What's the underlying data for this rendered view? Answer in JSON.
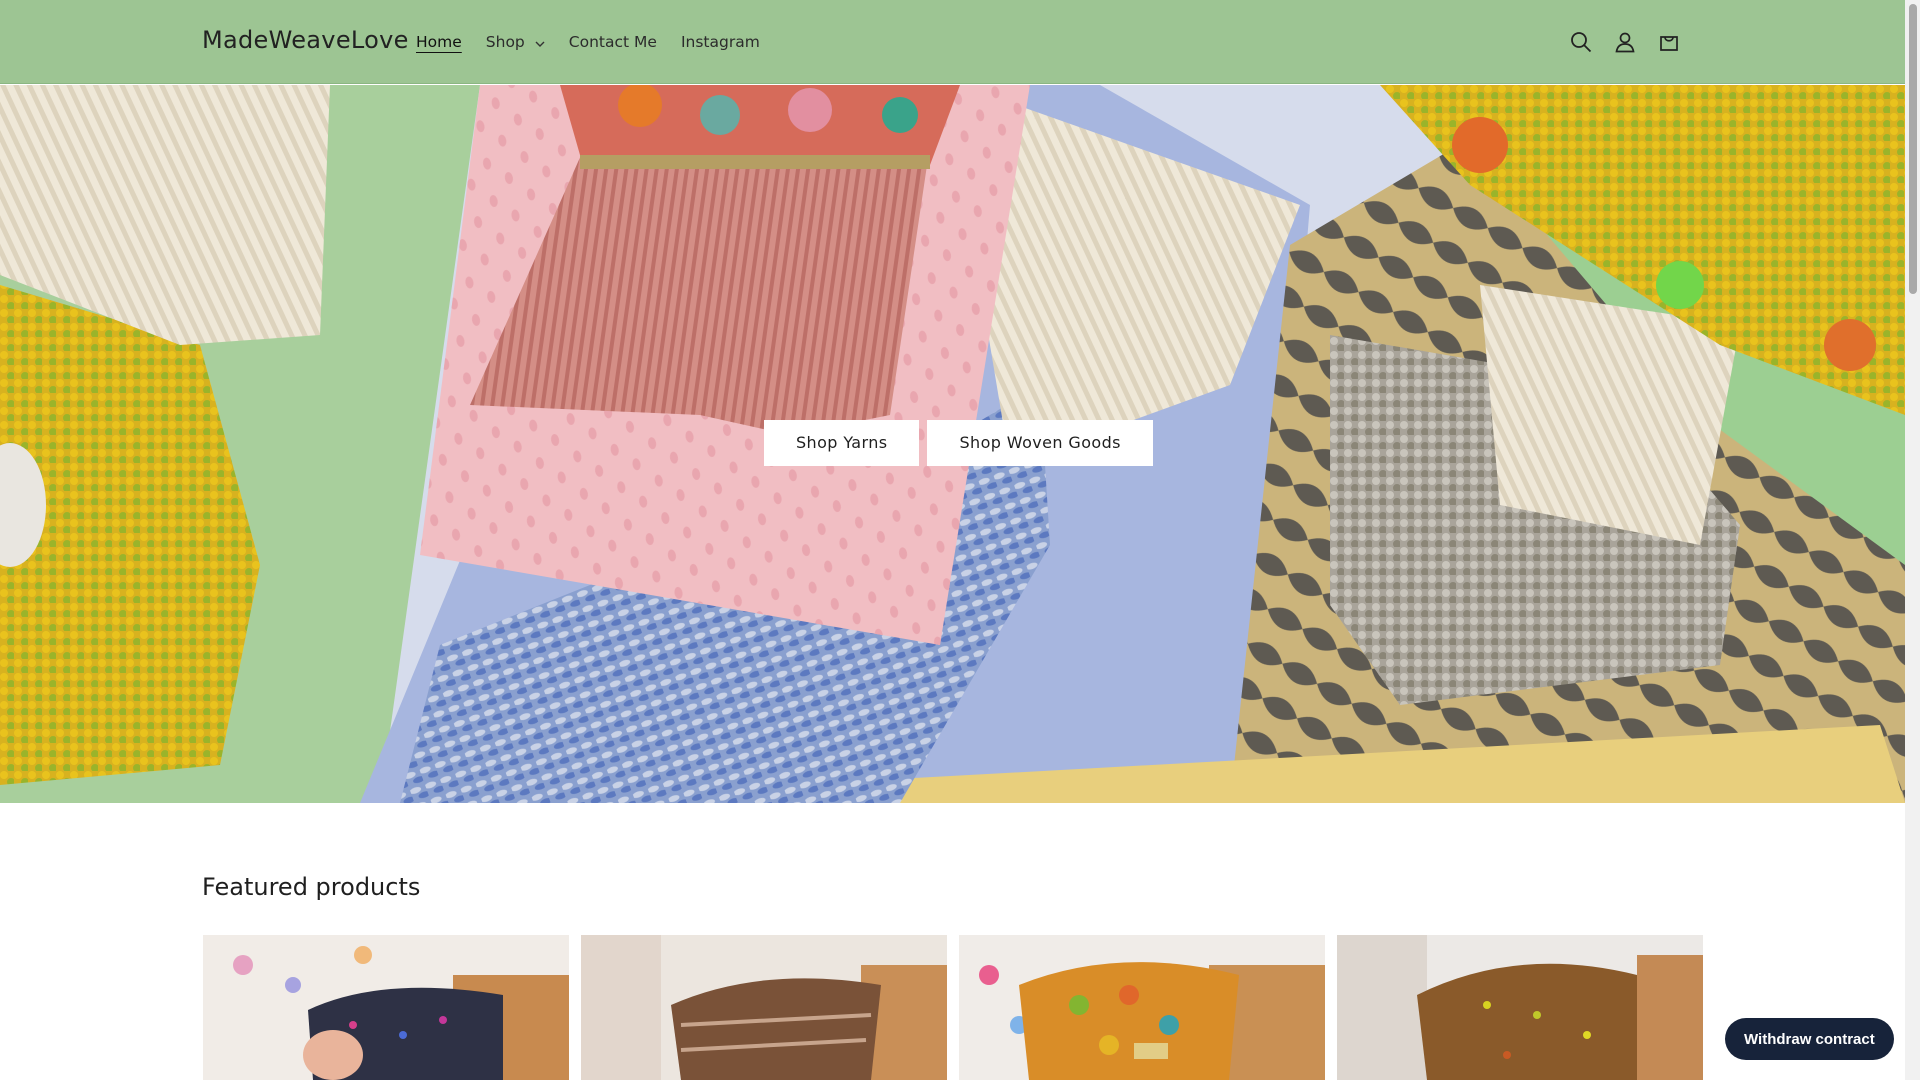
{
  "header": {
    "logo": "MadeWeaveLove",
    "nav": [
      {
        "label": "Home",
        "active": true
      },
      {
        "label": "Shop",
        "has_dropdown": true
      },
      {
        "label": "Contact Me"
      },
      {
        "label": "Instagram"
      }
    ],
    "icons": [
      "search-icon",
      "account-icon",
      "cart-icon"
    ],
    "background_color": "#9dc593"
  },
  "hero": {
    "buttons": [
      "Shop Yarns",
      "Shop Woven Goods"
    ]
  },
  "featured": {
    "title": "Featured products",
    "product_count_visible": 4
  },
  "withdraw_button": "Withdraw contract"
}
